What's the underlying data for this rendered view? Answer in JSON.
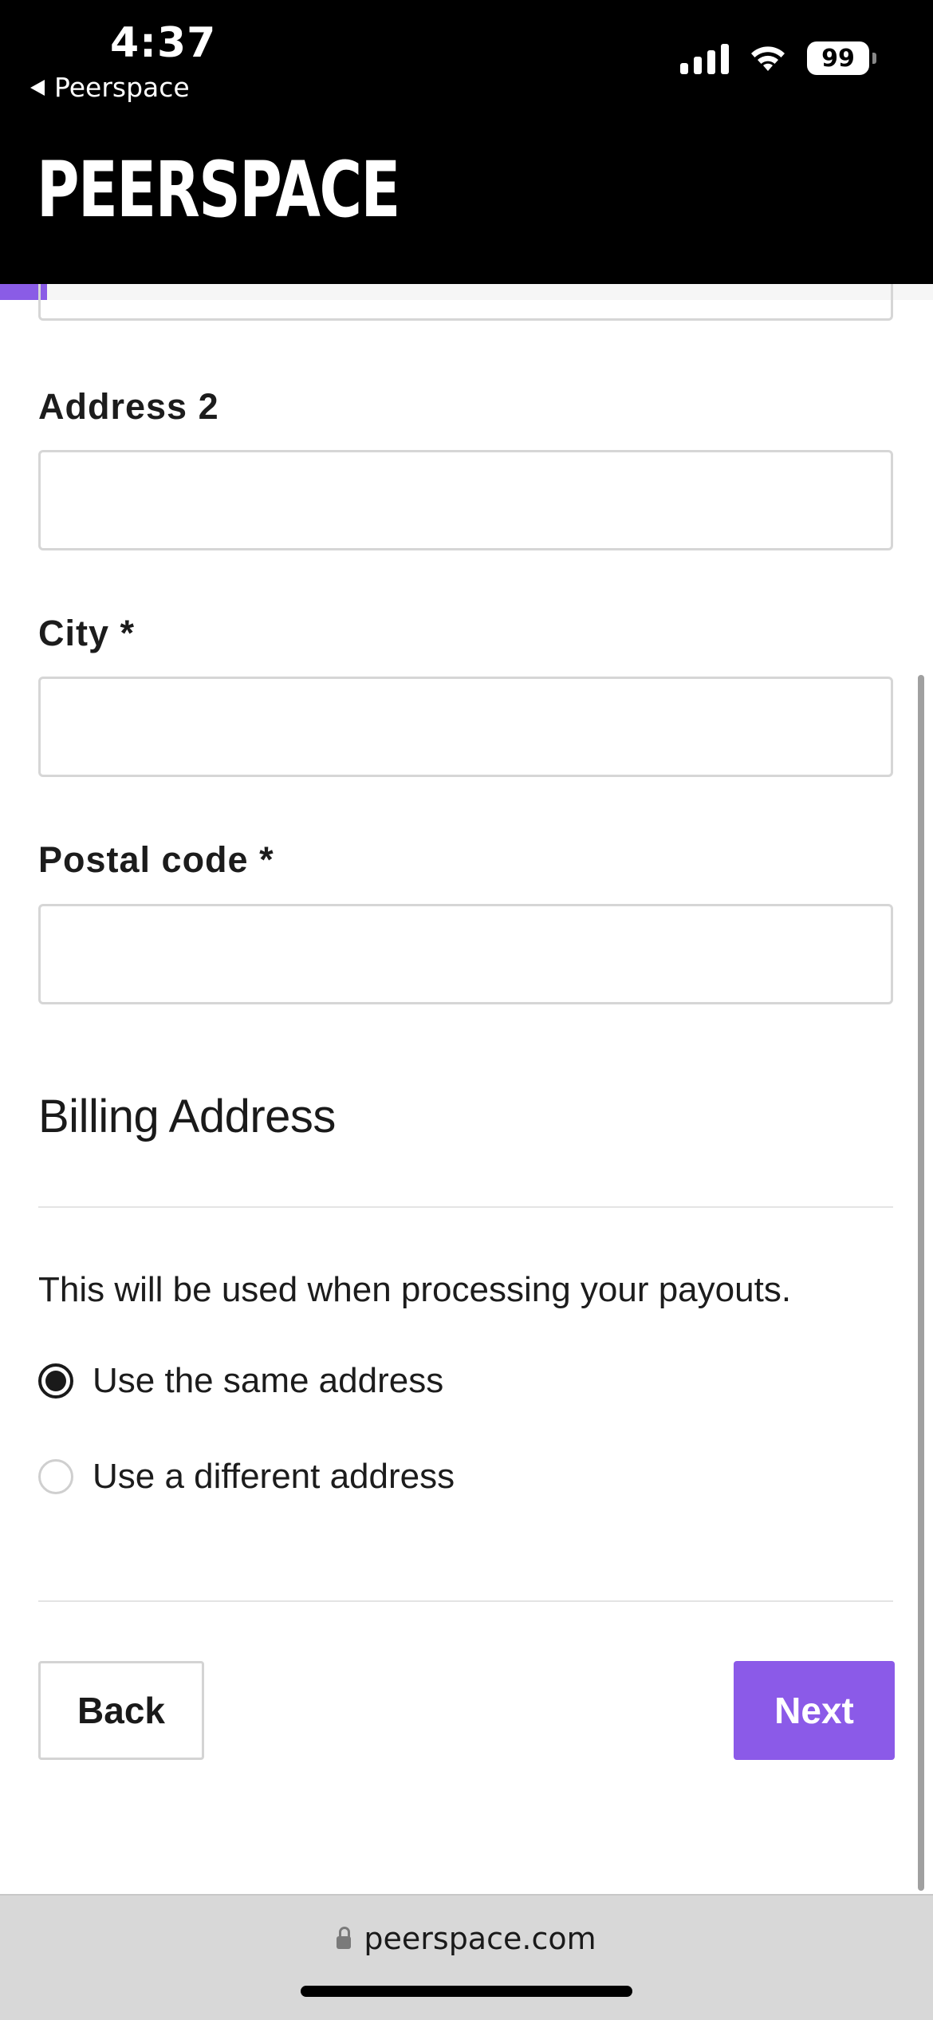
{
  "status_bar": {
    "time": "4:37",
    "back_app": "Peerspace",
    "battery": "99"
  },
  "header": {
    "logo": "PEERSPACE"
  },
  "progress": {
    "fraction": 0.05
  },
  "form": {
    "address2_label": "Address 2",
    "address2_value": "",
    "city_label": "City *",
    "city_value": "",
    "postal_label": "Postal code *",
    "postal_value": ""
  },
  "billing": {
    "title": "Billing Address",
    "help": "This will be used when processing your payouts.",
    "options": [
      {
        "label": "Use the same address",
        "selected": true
      },
      {
        "label": "Use a different address",
        "selected": false
      }
    ]
  },
  "actions": {
    "back": "Back",
    "next": "Next"
  },
  "browser": {
    "url": "peerspace.com"
  },
  "colors": {
    "accent": "#8b5ae8",
    "header_bg": "#000000"
  }
}
